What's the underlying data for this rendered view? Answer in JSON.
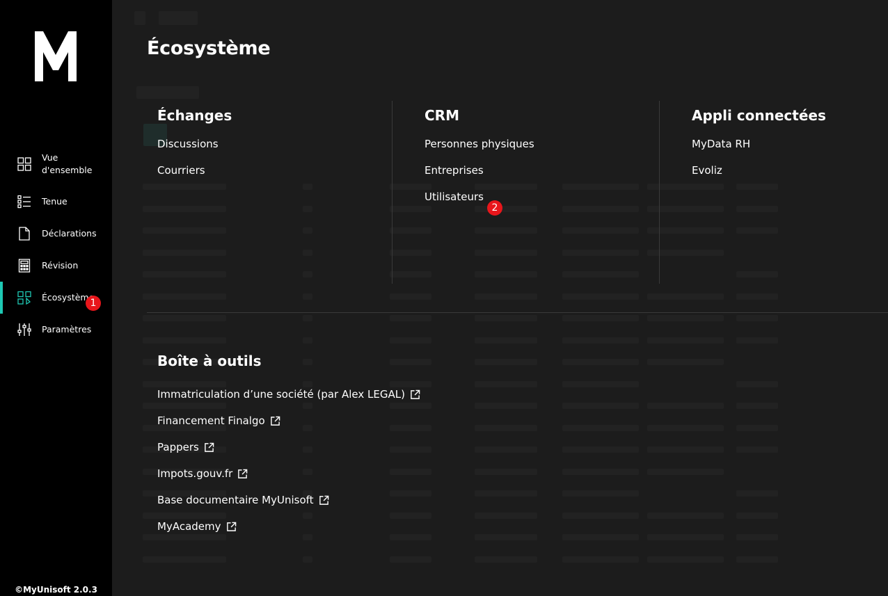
{
  "app": {
    "logo_text": "M",
    "version": "©MyUnisoft 2.0.3"
  },
  "sidebar": {
    "items": [
      {
        "label": "Vue d'ensemble",
        "icon": "grid-icon",
        "active": false
      },
      {
        "label": "Tenue",
        "icon": "list-icon",
        "active": false
      },
      {
        "label": "Déclarations",
        "icon": "document-icon",
        "active": false
      },
      {
        "label": "Révision",
        "icon": "calculator-icon",
        "active": false
      },
      {
        "label": "Écosystème",
        "icon": "ecosystem-icon",
        "active": true
      },
      {
        "label": "Paramètres",
        "icon": "sliders-icon",
        "active": false
      }
    ]
  },
  "badges": {
    "sidebar_marker": "1",
    "menu_marker": "2"
  },
  "menu": {
    "title": "Écosystème",
    "columns": [
      {
        "title": "Échanges",
        "links": [
          "Discussions",
          "Courriers"
        ]
      },
      {
        "title": "CRM",
        "links": [
          "Personnes physiques",
          "Entreprises",
          "Utilisateurs"
        ]
      },
      {
        "title": "Appli connectées",
        "links": [
          "MyData RH",
          "Evoliz"
        ]
      }
    ],
    "toolbox": {
      "title": "Boîte à outils",
      "links": [
        "Immatriculation d’une société (par Alex LEGAL)",
        "Financement Finalgo",
        "Pappers",
        "Impots.gouv.fr",
        "Base documentaire MyUnisoft",
        "MyAcademy"
      ]
    }
  },
  "colors": {
    "accent": "#1ec9b4",
    "badge": "#e8161b",
    "sidebar_bg": "#000000",
    "overlay_bg": "#1c1c1c"
  }
}
